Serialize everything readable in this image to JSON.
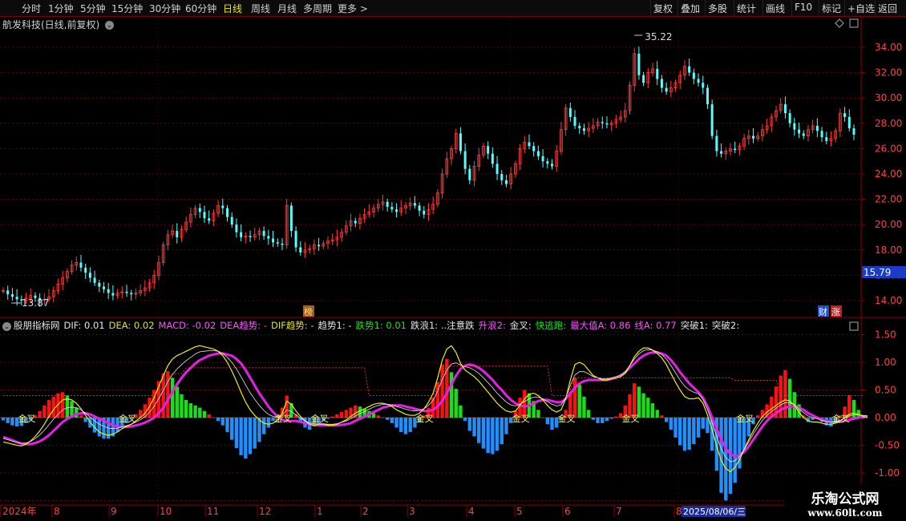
{
  "toolbar": {
    "periods": [
      "分时",
      "1分钟",
      "5分钟",
      "15分钟",
      "30分钟",
      "60分钟",
      "日线",
      "周线",
      "月线",
      "多周期",
      "更多 >"
    ],
    "active_period": "日线",
    "right_buttons": [
      "复权",
      "叠加",
      "多股",
      "统计",
      "画线",
      "F10",
      "标记",
      "+自选",
      "返回"
    ]
  },
  "stock_title": "航发科技(日线,前复权)",
  "price_chart": {
    "high_label": "35.22",
    "low_label": "13.87",
    "current_price_label": "15.79",
    "y_ticks": [
      "14.00",
      "16.00",
      "18.00",
      "20.00",
      "22.00",
      "24.00",
      "26.00",
      "28.00",
      "30.00",
      "32.00",
      "34.00"
    ],
    "badge_bang": "榜",
    "badge_cai": "财",
    "badge_zhang": "涨"
  },
  "indicator": {
    "name": "股朋指标网",
    "items": [
      {
        "label": "DIF: 0.01",
        "color": "#e6e6e6"
      },
      {
        "label": "DEA: 0.02",
        "color": "#e6e600"
      },
      {
        "label": "MACD: -0.02",
        "color": "#ff50ff"
      },
      {
        "label": "DEA趋势: -",
        "color": "#ff50ff"
      },
      {
        "label": "DIF趋势: -",
        "color": "#e6e600"
      },
      {
        "label": "趋势1: -",
        "color": "#e6e6e6"
      },
      {
        "label": "跌势1: 0.01",
        "color": "#20e020"
      },
      {
        "label": "跌浪1: ..注意跌",
        "color": "#e6e6e6"
      },
      {
        "label": "升浪2:",
        "color": "#ff50ff"
      },
      {
        "label": "金叉:",
        "color": "#e6e6e6"
      },
      {
        "label": "快逃跑:",
        "color": "#20e020"
      },
      {
        "label": "最大值A: 0.86",
        "color": "#ff50ff"
      },
      {
        "label": "线A: 0.77",
        "color": "#ff50ff"
      },
      {
        "label": "突破1:",
        "color": "#e6e6e6"
      },
      {
        "label": "突破2:",
        "color": "#e6e6e6"
      }
    ],
    "y_ticks": [
      "-1.50",
      "-1.00",
      "-0.50",
      "0.00",
      "0.50",
      "1.00",
      "1.50"
    ],
    "golden_cross_label": "金叉"
  },
  "date_axis": {
    "labels": [
      "2024年",
      "8",
      "9",
      "10",
      "11",
      "12",
      "1",
      "2",
      "3",
      "4",
      "5",
      "6",
      "7",
      "8"
    ],
    "cursor_date": "2025/08/06/三"
  },
  "watermark": {
    "line1": "乐淘公式网",
    "line2": "www.60lt.com"
  },
  "colors": {
    "up": "#ff3c3c",
    "down": "#54ffff",
    "macd_pos": "#ff1010",
    "macd_neg": "#1e90ff",
    "green_bar": "#18e018"
  },
  "chart_data": {
    "type": "candlestick",
    "price_ylim": [
      13,
      36
    ],
    "indicator_ylim": [
      -1.6,
      1.75
    ],
    "price_series": [
      14.8,
      14.5,
      14.3,
      14.1,
      14.0,
      14.2,
      14.4,
      14.2,
      14.0,
      14.1,
      14.3,
      14.8,
      15.3,
      15.8,
      16.3,
      16.8,
      17.0,
      16.6,
      16.2,
      15.8,
      15.4,
      15.1,
      14.9,
      14.6,
      14.4,
      14.6,
      14.7,
      14.6,
      14.5,
      14.6,
      14.8,
      15.0,
      15.4,
      16.0,
      17.0,
      18.4,
      19.2,
      19.5,
      19.0,
      19.6,
      20.2,
      20.8,
      21.3,
      21.0,
      20.5,
      20.3,
      20.9,
      21.5,
      21.3,
      20.6,
      20.0,
      19.4,
      19.0,
      19.1,
      19.0,
      19.2,
      19.5,
      19.1,
      18.9,
      18.6,
      18.5,
      18.4,
      21.5,
      19.5,
      18.2,
      17.8,
      18.0,
      18.1,
      18.4,
      18.3,
      18.5,
      18.7,
      18.8,
      19.0,
      19.4,
      19.9,
      20.3,
      20.1,
      20.5,
      20.8,
      21.0,
      21.3,
      21.6,
      21.8,
      21.4,
      21.2,
      21.0,
      21.3,
      21.5,
      21.7,
      21.5,
      21.1,
      20.8,
      21.2,
      21.6,
      22.5,
      24.0,
      25.2,
      26.0,
      27.2,
      25.8,
      24.4,
      23.5,
      24.6,
      25.5,
      26.2,
      25.6,
      24.8,
      24.0,
      23.5,
      23.2,
      24.0,
      24.8,
      26.0,
      26.5,
      26.2,
      25.8,
      25.4,
      25.0,
      24.8,
      24.6,
      25.8,
      27.5,
      29.2,
      28.5,
      27.8,
      27.6,
      27.4,
      27.6,
      27.8,
      28.1,
      28.0,
      27.9,
      28.0,
      28.3,
      28.5,
      29.0,
      31.0,
      33.5,
      31.8,
      31.2,
      32.0,
      32.3,
      31.5,
      30.8,
      30.5,
      30.8,
      31.2,
      31.8,
      32.5,
      32.0,
      31.5,
      31.2,
      30.8,
      29.5,
      27.0,
      25.8,
      25.6,
      25.8,
      26.0,
      25.9,
      26.2,
      26.8,
      27.0,
      26.8,
      27.0,
      27.5,
      27.8,
      28.5,
      29.0,
      29.5,
      28.8,
      28.0,
      27.5,
      27.2,
      27.0,
      27.5,
      27.8,
      27.4,
      26.9,
      26.6,
      26.8,
      27.4,
      28.8,
      28.5,
      27.6,
      27.1
    ],
    "macd_hist": [
      -0.05,
      -0.1,
      -0.14,
      -0.16,
      -0.15,
      -0.1,
      -0.04,
      0.04,
      0.12,
      0.22,
      0.32,
      0.38,
      0.44,
      0.46,
      0.4,
      0.3,
      0.18,
      0.04,
      -0.08,
      -0.18,
      -0.27,
      -0.34,
      -0.38,
      -0.38,
      -0.34,
      -0.26,
      -0.18,
      -0.1,
      -0.02,
      0.06,
      0.14,
      0.24,
      0.36,
      0.5,
      0.66,
      0.8,
      0.84,
      0.72,
      0.56,
      0.42,
      0.32,
      0.26,
      0.22,
      0.18,
      0.12,
      0.06,
      0.0,
      -0.06,
      -0.14,
      -0.26,
      -0.4,
      -0.55,
      -0.68,
      -0.74,
      -0.66,
      -0.56,
      -0.44,
      -0.3,
      -0.18,
      -0.06,
      0.04,
      0.18,
      0.4,
      0.26,
      0.06,
      -0.08,
      -0.18,
      -0.22,
      -0.16,
      -0.1,
      -0.05,
      -0.02,
      0.02,
      0.06,
      0.1,
      0.14,
      0.18,
      0.22,
      0.2,
      0.16,
      0.12,
      0.08,
      0.04,
      0.0,
      -0.04,
      -0.1,
      -0.18,
      -0.26,
      -0.3,
      -0.26,
      -0.18,
      -0.08,
      0.04,
      0.18,
      0.36,
      0.64,
      0.96,
      1.06,
      0.82,
      0.52,
      0.22,
      -0.06,
      -0.24,
      -0.34,
      -0.46,
      -0.56,
      -0.64,
      -0.66,
      -0.6,
      -0.48,
      -0.3,
      -0.1,
      0.12,
      0.36,
      0.5,
      0.44,
      0.3,
      0.14,
      0.0,
      -0.12,
      -0.22,
      -0.18,
      -0.04,
      0.14,
      0.46,
      0.72,
      0.6,
      0.38,
      0.14,
      -0.04,
      -0.1,
      -0.1,
      -0.06,
      -0.02,
      0.02,
      0.08,
      0.22,
      0.42,
      0.62,
      0.56,
      0.44,
      0.36,
      0.26,
      0.14,
      0.04,
      -0.08,
      -0.22,
      -0.36,
      -0.5,
      -0.6,
      -0.58,
      -0.48,
      -0.36,
      -0.2,
      -0.28,
      -0.6,
      -0.96,
      -1.36,
      -1.5,
      -1.38,
      -1.18,
      -0.92,
      -0.62,
      -0.34,
      -0.12,
      0.04,
      0.14,
      0.24,
      0.38,
      0.56,
      0.76,
      0.86,
      0.7,
      0.46,
      0.24,
      0.04,
      -0.08,
      -0.04,
      -0.02,
      -0.08,
      -0.14,
      -0.16,
      -0.1,
      0.04,
      0.2,
      0.4,
      0.32,
      0.14,
      -0.02
    ],
    "dif_series": [
      -0.44,
      -0.46,
      -0.48,
      -0.5,
      -0.51,
      -0.48,
      -0.42,
      -0.34,
      -0.24,
      -0.12,
      0.02,
      0.14,
      0.24,
      0.32,
      0.34,
      0.32,
      0.26,
      0.16,
      0.04,
      -0.08,
      -0.18,
      -0.26,
      -0.3,
      -0.32,
      -0.3,
      -0.26,
      -0.2,
      -0.16,
      -0.12,
      -0.06,
      0.0,
      0.08,
      0.2,
      0.36,
      0.56,
      0.76,
      0.94,
      1.06,
      1.12,
      1.16,
      1.2,
      1.24,
      1.28,
      1.3,
      1.28,
      1.26,
      1.24,
      1.2,
      1.12,
      1.0,
      0.84,
      0.66,
      0.46,
      0.28,
      0.14,
      0.04,
      -0.04,
      -0.1,
      -0.12,
      -0.1,
      -0.04,
      0.08,
      0.3,
      0.24,
      0.12,
      0.02,
      -0.06,
      -0.12,
      -0.14,
      -0.12,
      -0.12,
      -0.14,
      -0.14,
      -0.12,
      -0.08,
      -0.04,
      0.02,
      0.08,
      0.12,
      0.16,
      0.2,
      0.24,
      0.26,
      0.26,
      0.24,
      0.2,
      0.14,
      0.1,
      0.06,
      0.04,
      0.04,
      0.08,
      0.16,
      0.28,
      0.44,
      0.72,
      1.04,
      1.24,
      1.3,
      1.18,
      0.98,
      0.86,
      0.8,
      0.74,
      0.66,
      0.56,
      0.46,
      0.36,
      0.26,
      0.18,
      0.12,
      0.1,
      0.12,
      0.22,
      0.34,
      0.42,
      0.44,
      0.4,
      0.32,
      0.22,
      0.14,
      0.1,
      0.14,
      0.34,
      0.68,
      0.96,
      1.0,
      0.96,
      0.86,
      0.76,
      0.72,
      0.68,
      0.68,
      0.7,
      0.72,
      0.74,
      0.8,
      0.94,
      1.1,
      1.2,
      1.26,
      1.26,
      1.22,
      1.16,
      1.08,
      0.96,
      0.8,
      0.64,
      0.5,
      0.38,
      0.34,
      0.34,
      0.36,
      0.26,
      0.04,
      -0.22,
      -0.52,
      -0.78,
      -0.92,
      -0.98,
      -0.9,
      -0.76,
      -0.58,
      -0.4,
      -0.24,
      -0.1,
      0.02,
      0.1,
      0.16,
      0.22,
      0.28,
      0.32,
      0.3,
      0.22,
      0.1,
      0.0,
      -0.06,
      -0.08,
      -0.08,
      -0.1,
      -0.12,
      -0.12,
      -0.1,
      -0.06,
      0.0,
      0.06,
      0.08,
      0.06,
      0.02,
      0.0
    ],
    "dea_series": [
      -0.35,
      -0.38,
      -0.41,
      -0.44,
      -0.47,
      -0.48,
      -0.48,
      -0.46,
      -0.43,
      -0.38,
      -0.32,
      -0.24,
      -0.16,
      -0.08,
      -0.02,
      0.02,
      0.06,
      0.08,
      0.08,
      0.06,
      0.02,
      -0.02,
      -0.06,
      -0.1,
      -0.14,
      -0.16,
      -0.17,
      -0.17,
      -0.16,
      -0.14,
      -0.12,
      -0.09,
      -0.05,
      0.0,
      0.08,
      0.18,
      0.32,
      0.46,
      0.6,
      0.72,
      0.82,
      0.9,
      0.98,
      1.04,
      1.08,
      1.12,
      1.14,
      1.16,
      1.16,
      1.14,
      1.12,
      1.06,
      0.98,
      0.86,
      0.72,
      0.58,
      0.44,
      0.32,
      0.2,
      0.1,
      0.02,
      -0.04,
      -0.06,
      -0.06,
      -0.06,
      -0.08,
      -0.1,
      -0.12,
      -0.13,
      -0.14,
      -0.14,
      -0.14,
      -0.14,
      -0.14,
      -0.13,
      -0.12,
      -0.1,
      -0.06,
      -0.02,
      0.02,
      0.06,
      0.1,
      0.14,
      0.18,
      0.2,
      0.22,
      0.22,
      0.22,
      0.2,
      0.18,
      0.16,
      0.14,
      0.12,
      0.12,
      0.14,
      0.2,
      0.3,
      0.44,
      0.6,
      0.76,
      0.88,
      0.94,
      0.96,
      0.94,
      0.9,
      0.84,
      0.76,
      0.68,
      0.58,
      0.5,
      0.4,
      0.32,
      0.26,
      0.22,
      0.2,
      0.22,
      0.26,
      0.3,
      0.32,
      0.32,
      0.3,
      0.28,
      0.28,
      0.34,
      0.44,
      0.54,
      0.62,
      0.66,
      0.68,
      0.68,
      0.68,
      0.68,
      0.68,
      0.7,
      0.72,
      0.76,
      0.82,
      0.9,
      0.98,
      1.06,
      1.12,
      1.16,
      1.18,
      1.18,
      1.16,
      1.12,
      1.04,
      0.94,
      0.82,
      0.72,
      0.62,
      0.54,
      0.46,
      0.36,
      0.2,
      0.0,
      -0.2,
      -0.4,
      -0.56,
      -0.66,
      -0.7,
      -0.68,
      -0.62,
      -0.52,
      -0.4,
      -0.28,
      -0.16,
      -0.06,
      0.02,
      0.08,
      0.14,
      0.18,
      0.2,
      0.2,
      0.18,
      0.14,
      0.08,
      0.04,
      0.0,
      -0.04,
      -0.06,
      -0.08,
      -0.08,
      -0.08,
      -0.06,
      -0.04,
      -0.02,
      0.0,
      0.02,
      0.02
    ]
  }
}
